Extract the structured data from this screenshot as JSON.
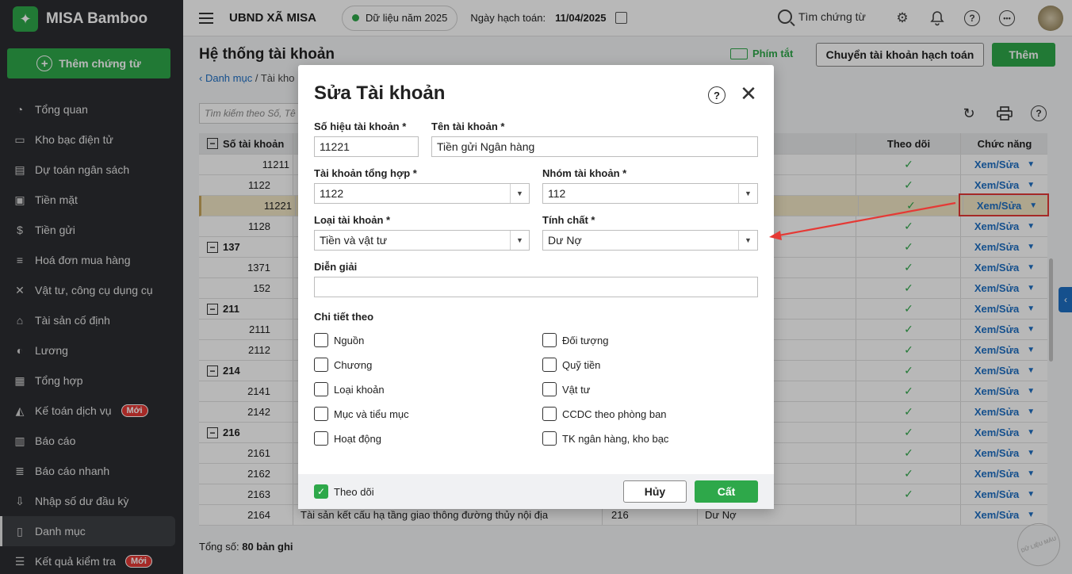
{
  "app": {
    "brand": "MISA Bamboo",
    "add_voucher": "Thêm chứng từ"
  },
  "sidebar": {
    "items": [
      {
        "label": "Tổng quan",
        "icon": "pie-chart-icon"
      },
      {
        "label": "Kho bạc điện tử",
        "icon": "monitor-icon"
      },
      {
        "label": "Dự toán ngân sách",
        "icon": "budget-icon"
      },
      {
        "label": "Tiền mặt",
        "icon": "wallet-icon"
      },
      {
        "label": "Tiền gửi",
        "icon": "deposit-icon"
      },
      {
        "label": "Hoá đơn mua hàng",
        "icon": "invoice-icon"
      },
      {
        "label": "Vật tư, công cụ dụng cụ",
        "icon": "tools-icon"
      },
      {
        "label": "Tài sản cố định",
        "icon": "building-icon"
      },
      {
        "label": "Lương",
        "icon": "salary-icon"
      },
      {
        "label": "Tổng hợp",
        "icon": "summary-icon"
      },
      {
        "label": "Kế toán dịch vụ",
        "icon": "service-icon",
        "badge": "Mới"
      },
      {
        "label": "Báo cáo",
        "icon": "report-icon"
      },
      {
        "label": "Báo cáo nhanh",
        "icon": "quick-report-icon"
      },
      {
        "label": "Nhập số dư đầu kỳ",
        "icon": "opening-balance-icon"
      },
      {
        "label": "Danh mục",
        "icon": "catalog-icon",
        "active": true
      },
      {
        "label": "Kết quả kiểm tra",
        "icon": "check-result-icon",
        "badge": "Mới"
      }
    ]
  },
  "topbar": {
    "org": "UBND XÃ MISA",
    "year_label": "Dữ liệu năm 2025",
    "posting_date_label": "Ngày hạch toán:",
    "posting_date": "11/04/2025",
    "search_label": "Tìm chứng từ"
  },
  "page": {
    "title": "Hệ thống tài khoản",
    "breadcrumb_link": "Danh mục",
    "breadcrumb_current": "Tài kho",
    "shortcut_label": "Phím tắt",
    "transfer_button": "Chuyển tài khoản hạch toán",
    "add_button": "Thêm",
    "search_placeholder": "Tìm kiếm theo Số, Tê",
    "total_label": "Tổng số:",
    "total_count": "80 bản ghi"
  },
  "table": {
    "headers": {
      "account_no": "Số tài khoản",
      "track": "Theo dõi",
      "function": "Chức năng"
    },
    "action_label": "Xem/Sửa",
    "rows": [
      {
        "no": "11211",
        "level": 2,
        "check": true
      },
      {
        "no": "1122",
        "level": 1,
        "check": true
      },
      {
        "no": "11221",
        "level": 2,
        "check": true,
        "selected": true
      },
      {
        "no": "1128",
        "level": 1,
        "check": true
      },
      {
        "no": "137",
        "level": 0,
        "group": true,
        "check": true
      },
      {
        "no": "1371",
        "level": 1,
        "check": true
      },
      {
        "no": "152",
        "level": 0,
        "check": true
      },
      {
        "no": "211",
        "level": 0,
        "group": true,
        "check": true
      },
      {
        "no": "2111",
        "level": 1,
        "check": true
      },
      {
        "no": "2112",
        "level": 1,
        "check": true
      },
      {
        "no": "214",
        "level": 0,
        "group": true,
        "check": true
      },
      {
        "no": "2141",
        "level": 1,
        "check": true
      },
      {
        "no": "2142",
        "level": 1,
        "check": true
      },
      {
        "no": "216",
        "level": 0,
        "group": true,
        "check": true
      },
      {
        "no": "2161",
        "level": 1,
        "check": true
      },
      {
        "no": "2162",
        "level": 1,
        "check": true
      },
      {
        "no": "2163",
        "level": 1,
        "check": true
      },
      {
        "no": "2164",
        "level": 1,
        "check": false,
        "name": "Tài sản kết cấu hạ tầng giao thông đường thủy nội địa",
        "parent": "216",
        "nature": "Dư Nợ"
      }
    ]
  },
  "dialog": {
    "title": "Sửa Tài khoản",
    "account_no_label": "Số hiệu tài khoản *",
    "account_no_value": "11221",
    "account_name_label": "Tên tài khoản *",
    "account_name_value": "Tiền gửi Ngân hàng",
    "parent_label": "Tài khoản tổng hợp *",
    "parent_value": "1122",
    "group_label": "Nhóm tài khoản *",
    "group_value": "112",
    "type_label": "Loại tài khoản *",
    "type_value": "Tiền và vật tư",
    "nature_label": "Tính chất *",
    "nature_value": "Dư Nợ",
    "desc_label": "Diễn giải",
    "desc_value": "",
    "detail_label": "Chi tiết theo",
    "detail_left": [
      "Nguồn",
      "Chương",
      "Loại khoản",
      "Mục và tiểu mục",
      "Hoạt động"
    ],
    "detail_right": [
      "Đối tượng",
      "Quỹ tiền",
      "Vật tư",
      "CCDC theo phòng ban",
      "TK ngân hàng, kho bạc"
    ],
    "track_label": "Theo dõi",
    "cancel": "Hủy",
    "save": "Cất"
  },
  "watermark": "DỮ LIỆU MẪU",
  "colors": {
    "brand_green": "#2ea84a",
    "link_blue": "#1e6fc4",
    "annotation_red": "#e53935",
    "sidebar_bg": "#2b2d31"
  }
}
